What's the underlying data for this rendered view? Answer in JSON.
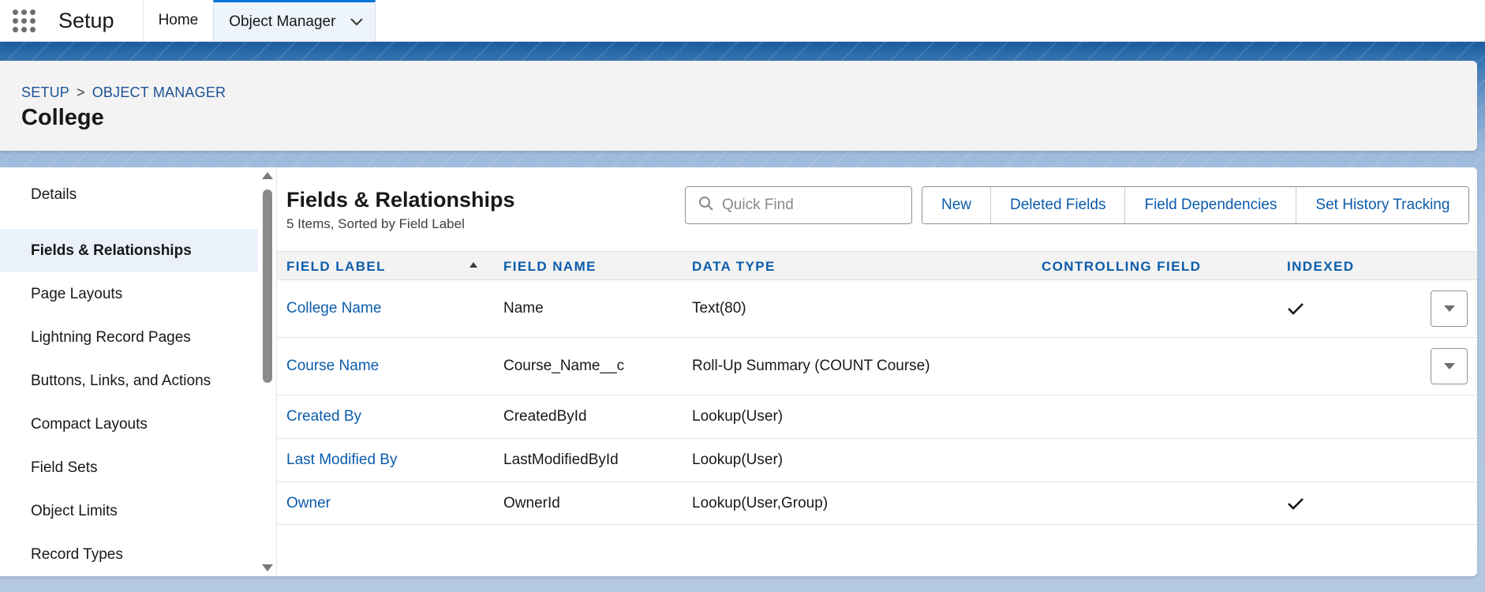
{
  "topnav": {
    "app_name": "Setup",
    "tabs": [
      {
        "label": "Home"
      },
      {
        "label": "Object Manager"
      }
    ]
  },
  "header": {
    "breadcrumb": [
      "SETUP",
      "OBJECT MANAGER"
    ],
    "breadcrumb_separator": ">",
    "title": "College"
  },
  "sidebar": {
    "items": [
      {
        "label": "Details"
      },
      {
        "label": "Fields & Relationships"
      },
      {
        "label": "Page Layouts"
      },
      {
        "label": "Lightning Record Pages"
      },
      {
        "label": "Buttons, Links, and Actions"
      },
      {
        "label": "Compact Layouts"
      },
      {
        "label": "Field Sets"
      },
      {
        "label": "Object Limits"
      },
      {
        "label": "Record Types"
      }
    ],
    "active": "Fields & Relationships"
  },
  "section": {
    "title": "Fields & Relationships",
    "subtitle": "5 Items, Sorted by Field Label",
    "quick_find_placeholder": "Quick Find",
    "buttons": {
      "new": "New",
      "deleted_fields": "Deleted Fields",
      "field_dependencies": "Field Dependencies",
      "set_history_tracking": "Set History Tracking"
    }
  },
  "table": {
    "columns": {
      "field_label": "FIELD LABEL",
      "field_name": "FIELD NAME",
      "data_type": "DATA TYPE",
      "controlling_field": "CONTROLLING FIELD",
      "indexed": "INDEXED"
    },
    "rows": [
      {
        "label": "College Name",
        "name": "Name",
        "type": "Text(80)",
        "controlling": "",
        "indexed": true,
        "menu": true
      },
      {
        "label": "Course Name",
        "name": "Course_Name__c",
        "type": "Roll-Up Summary (COUNT Course)",
        "controlling": "",
        "indexed": false,
        "menu": true
      },
      {
        "label": "Created By",
        "name": "CreatedById",
        "type": "Lookup(User)",
        "controlling": "",
        "indexed": false,
        "menu": false
      },
      {
        "label": "Last Modified By",
        "name": "LastModifiedById",
        "type": "Lookup(User)",
        "controlling": "",
        "indexed": false,
        "menu": false
      },
      {
        "label": "Owner",
        "name": "OwnerId",
        "type": "Lookup(User,Group)",
        "controlling": "",
        "indexed": true,
        "menu": false
      }
    ]
  },
  "icons": {
    "app_launcher": "waffle-icon",
    "tab_menu": "chevron-down-icon",
    "search": "search-icon",
    "indexed": "checkmark-icon",
    "row_menu": "down-triangle-icon"
  },
  "colors": {
    "brand_blue": "#0176d3",
    "link_blue": "#0b5cab"
  }
}
